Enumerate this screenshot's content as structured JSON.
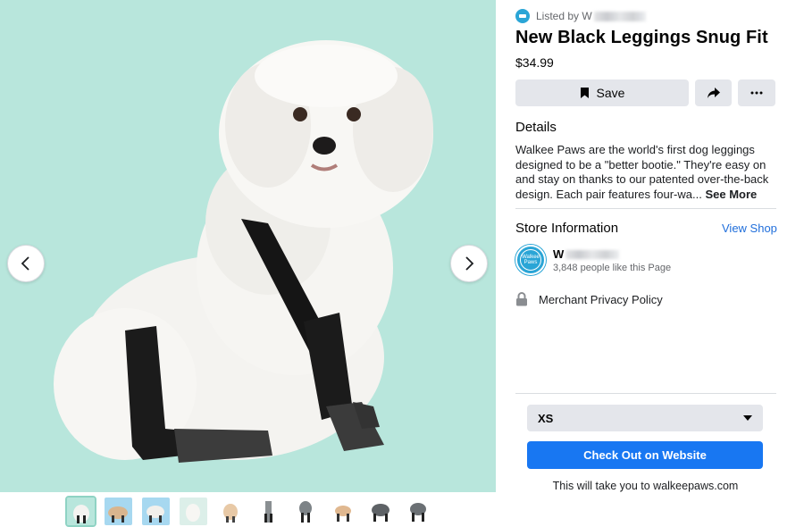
{
  "listing": {
    "listed_by_prefix": "Listed by W",
    "title": "New Black Leggings Snug Fit",
    "price": "$34.99"
  },
  "actions": {
    "save_label": "Save",
    "share_icon": "share-arrow-icon",
    "more_icon": "more-dots-icon"
  },
  "details": {
    "heading": "Details",
    "description": "Walkee Paws are the world's first dog leggings designed to be a \"better bootie.\" They're easy on and stay on thanks to our patented over-the-back design. Each pair features four-wa...",
    "see_more": "See More"
  },
  "store": {
    "heading": "Store Information",
    "view_shop": "View Shop",
    "name_prefix": "W",
    "likes": "3,848 people like this Page",
    "logo_text": "Walkee Paws",
    "privacy_label": "Merchant Privacy Policy"
  },
  "purchase": {
    "size_selected": "XS",
    "checkout_label": "Check Out on Website",
    "note": "This will take you to walkeepaws.com"
  },
  "colors": {
    "image_background": "#b8e6dc",
    "checkout_blue": "#1877f2",
    "link_blue": "#216fdb",
    "button_gray": "#e4e6eb"
  }
}
